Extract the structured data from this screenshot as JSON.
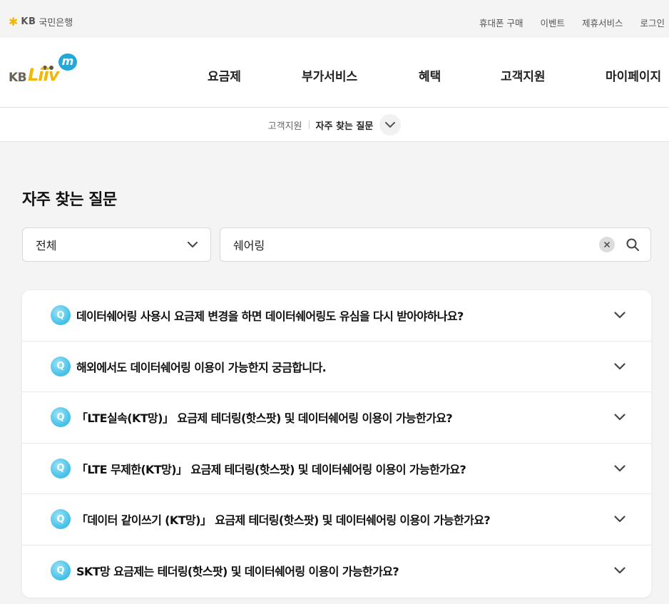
{
  "util_bar": {
    "bank_name": "국민은행",
    "bank_prefix": "KB",
    "links": [
      "휴대폰 구매",
      "이벤트",
      "제휴서비스",
      "로그인"
    ]
  },
  "header": {
    "logo_kb": "KB",
    "logo_liiv": "Liiv",
    "logo_m": "m",
    "nav": [
      "요금제",
      "부가서비스",
      "혜택",
      "고객지원",
      "마이페이지"
    ]
  },
  "breadcrumb": {
    "parent": "고객지원",
    "current": "자주 찾는 질문"
  },
  "page": {
    "title": "자주 찾는 질문"
  },
  "filters": {
    "category_selected": "전체",
    "search_value": "쉐어링"
  },
  "faq": {
    "badge": "Q",
    "items": [
      "데이터쉐어링 사용시 요금제 변경을 하면 데이터쉐어링도 유심을 다시 받아야하나요?",
      "해외에서도 데이터쉐어링 이용이 가능한지 궁금합니다.",
      "「LTE실속(KT망)」 요금제 테더링(핫스팟) 및 데이터쉐어링 이용이 가능한가요?",
      "「LTE 무제한(KT망)」 요금제 테더링(핫스팟) 및 데이터쉐어링 이용이 가능한가요?",
      "「데이터 같이쓰기 (KT망)」 요금제 테더링(핫스팟) 및 데이터쉐어링 이용이 가능한가요?",
      "SKT망 요금제는 테더링(핫스팟) 및 데이터쉐어링 이용이 가능한가요?"
    ]
  },
  "colors": {
    "brand_yellow": "#f2b705",
    "brand_blue": "#23a8d8",
    "background": "#f4f4f4"
  }
}
